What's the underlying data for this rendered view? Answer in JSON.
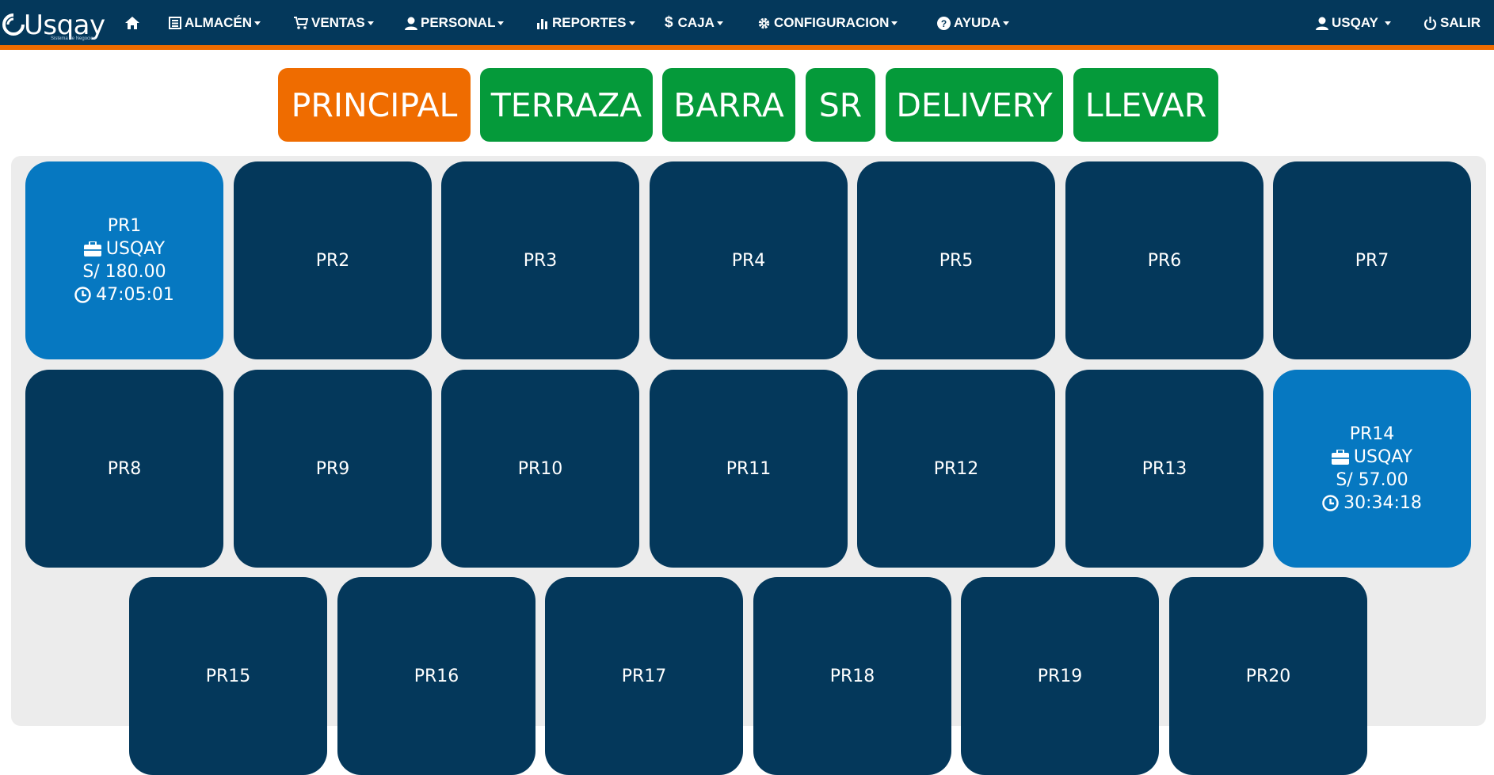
{
  "brand": {
    "name": "Usqay",
    "subtitle": "Sistema de Negocios"
  },
  "nav": {
    "almacen": "ALMACÉN",
    "ventas": "VENTAS",
    "personal": "PERSONAL",
    "reportes": "REPORTES",
    "caja": "CAJA",
    "configuracion": "CONFIGURACION",
    "ayuda": "AYUDA",
    "user": "USQAY",
    "salir": "SALIR"
  },
  "colors": {
    "nav_bg": "#04385b",
    "accent": "#ef6c00",
    "tab_active": "#ef6c00",
    "tab_inactive": "#059a3a",
    "table_free": "#04385b",
    "table_occupied": "#0678c1"
  },
  "rooms": [
    "PRINCIPAL",
    "TERRAZA",
    "BARRA",
    "SR",
    "DELIVERY",
    "LLEVAR"
  ],
  "active_room": "PRINCIPAL",
  "tables": [
    {
      "name": "PR1",
      "occupied": true,
      "waiter": "USQAY",
      "amount": "S/ 180.00",
      "time": "47:05:01"
    },
    {
      "name": "PR2"
    },
    {
      "name": "PR3"
    },
    {
      "name": "PR4"
    },
    {
      "name": "PR5"
    },
    {
      "name": "PR6"
    },
    {
      "name": "PR7"
    },
    {
      "name": "PR8"
    },
    {
      "name": "PR9"
    },
    {
      "name": "PR10"
    },
    {
      "name": "PR11"
    },
    {
      "name": "PR12"
    },
    {
      "name": "PR13"
    },
    {
      "name": "PR14",
      "occupied": true,
      "waiter": "USQAY",
      "amount": "S/ 57.00",
      "time": "30:34:18"
    },
    {
      "name": "PR15"
    },
    {
      "name": "PR16"
    },
    {
      "name": "PR17"
    },
    {
      "name": "PR18"
    },
    {
      "name": "PR19"
    },
    {
      "name": "PR20"
    }
  ]
}
